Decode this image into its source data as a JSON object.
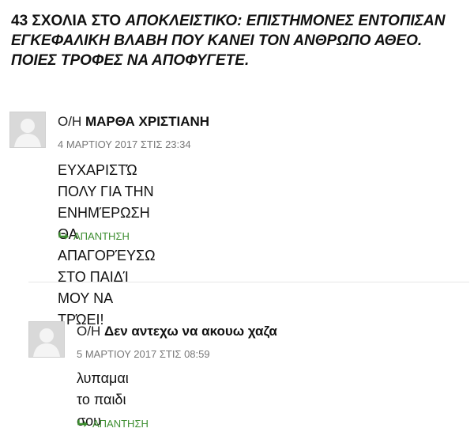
{
  "header": {
    "count": "43",
    "label": "ΣΧΟΛΙΑ ΣΤΟ",
    "article_line1": "ΑΠΟΚΛΕΙΣΤΙΚΟ: ΕΠΙΣΤΗΜΟΝΕΣ ΕΝΤΟΠΙΣΑΝ",
    "article_line2": "ΕΓΚΕΦΑΛΙΚΗ ΒΛΑΒΗ ΠΟΥ ΚΑΝΕΙ ΤΟΝ ΑΝΘΡΩΠΟ ΑΘΕΟ.",
    "article_line3": "ΠΟΙΕΣ ΤΡΟΦΕΣ ΝΑ ΑΠΟΦΥΓΕΤΕ."
  },
  "comments": [
    {
      "prefix": "Ο/Η",
      "author": "ΜΑΡΘΑ ΧΡΙΣΤΙΑΝΗ",
      "date": "4 ΜΑΡΤΙΟΥ 2017 ΣΤΙΣ 23:34",
      "text_line1": "ΕΥΧΑΡΙΣΤΏ ΠΟΛΥ ΓΙΑ ΤΗΝ ΕΝΗΜΈΡΩΣΗ ΘΑ",
      "text_line2": "ΑΠΑΓΟΡΈΥΣΩ ΣΤΟ ΠΑΙΔΊ ΜΟΥ ΝΑ ΤΡΏΕΙ!",
      "reply_label": "ΑΠΑΝΤΗΣΗ"
    },
    {
      "prefix": "Ο/Η",
      "author": "Δεν αντεχω να ακουω χαζα",
      "date": "5 ΜΑΡΤΙΟΥ 2017 ΣΤΙΣ 08:59",
      "text_line1": "λυπαμαι το παιδι σου",
      "reply_label": "ΑΠΑΝΤΗΣΗ"
    }
  ],
  "icons": {
    "avatar": "default-avatar-icon",
    "reply": "reply-arrow-icon"
  },
  "colors": {
    "reply": "#3c8d2f",
    "date": "#777777",
    "avatar_bg": "#d9d9d9"
  }
}
